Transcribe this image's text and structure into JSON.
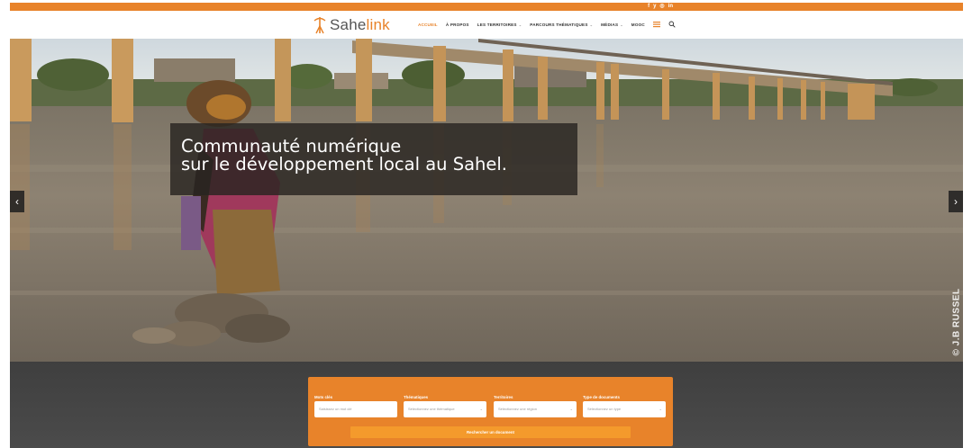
{
  "social": {
    "icons": [
      "facebook-icon",
      "twitter-icon",
      "instagram-icon",
      "linkedin-icon"
    ],
    "glyphs": [
      "f",
      "y",
      "◎",
      "in"
    ]
  },
  "brand": {
    "name_part1": "Sahe",
    "name_part2": "link",
    "accent_color": "#e8832a"
  },
  "nav": {
    "items": [
      {
        "label": "ACCUEIL",
        "active": true
      },
      {
        "label": "À PROPOS"
      },
      {
        "label": "LES TERRITOIRES"
      },
      {
        "label": "PARCOURS THÉMATIQUES"
      },
      {
        "label": "MÉDIAS"
      },
      {
        "label": "MOOC"
      }
    ],
    "caret": "⌄",
    "search_icon": "search-icon",
    "menu_icon": "hamburger-icon"
  },
  "hero": {
    "caption_line1": "Communauté numérique",
    "caption_line2": "sur le développement local au Sahel.",
    "prev": "‹",
    "next": "›",
    "credit": "© J.B RUSSEL"
  },
  "search": {
    "fields": [
      {
        "label": "Mots clés",
        "placeholder": "Saisissez un mot clé"
      },
      {
        "label": "Thématiques",
        "placeholder": "Sélectionnez une thématique"
      },
      {
        "label": "Territoires",
        "placeholder": "Sélectionnez une région"
      },
      {
        "label": "Type de documents",
        "placeholder": "Sélectionnez un type"
      }
    ],
    "caret": "⌄",
    "button_label": "Rechercher un document"
  }
}
